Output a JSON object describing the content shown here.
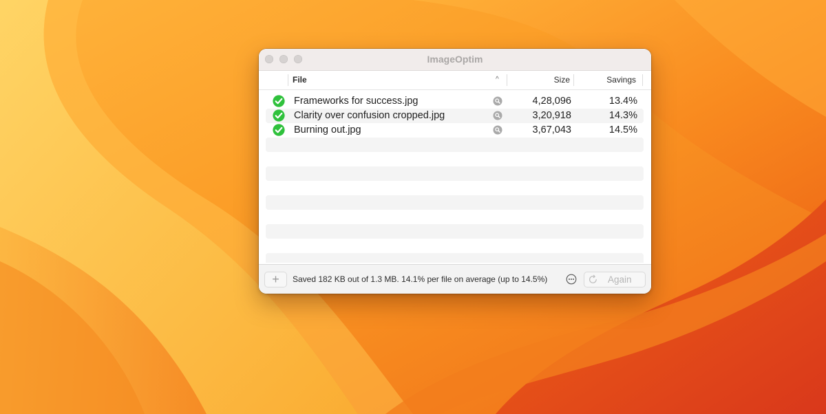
{
  "window": {
    "title": "ImageOptim"
  },
  "columns": {
    "file": "File",
    "size": "Size",
    "savings": "Savings",
    "sort_indicator": "^"
  },
  "files": [
    {
      "name": "Frameworks for success.jpg",
      "size": "4,28,096",
      "savings": "13.4%",
      "status_icon": "checkmark-circle-icon"
    },
    {
      "name": "Clarity over confusion cropped.jpg",
      "size": "3,20,918",
      "savings": "14.3%",
      "status_icon": "checkmark-circle-icon"
    },
    {
      "name": "Burning out.jpg",
      "size": "3,67,043",
      "savings": "14.5%",
      "status_icon": "checkmark-circle-icon"
    }
  ],
  "footer": {
    "add_label": "+",
    "status": "Saved 182 KB out of 1.3 MB. 14.1% per file on average (up to 14.5%)",
    "again_label": "Again"
  },
  "colors": {
    "success_green": "#2fc13c",
    "row_stripe": "#f4f4f4",
    "titlebar": "#f1eceb",
    "wallpaper_orange": "#f7931e"
  }
}
